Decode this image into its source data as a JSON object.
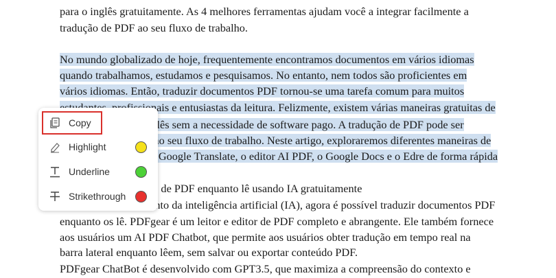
{
  "document": {
    "lines": [
      {
        "text": "para o inglês gratuitamente. As 4 melhores ferramentas ajudam você a integrar facilmente a"
      },
      {
        "text": "tradução de PDF ao seu fluxo de trabalho."
      },
      {
        "text": ""
      },
      {
        "text": "No mundo globalizado de hoje, frequentemente encontramos documentos em vários idiomas"
      },
      {
        "text": "quando trabalhamos, estudamos e pesquisamos. No entanto, nem todos são proficientes em"
      },
      {
        "text": "vários idiomas. Então, traduzir documentos PDF tornou-se uma tarefa comum para muitos"
      },
      {
        "text": "estudantes, profissionais e entusiastas da leitura. Felizmente, existem várias maneiras gratuitas de"
      },
      {
        "text": "traduzir PDF para inglês sem a necessidade de software pago. A tradução de PDF pode ser"
      },
      {
        "text": "integrada facilmente ao seu fluxo de trabalho. Neste artigo, exploraremos diferentes maneiras de"
      },
      {
        "text": "traduzir PDF, como o Google Translate, o editor AI PDF, o Google Docs e o Edre de forma rápida"
      },
      {
        "text": ""
      },
      {
        "text": "1. PDFgear: Tradução de PDF enquanto lê usando IA gratuitamente"
      },
      {
        "text": "Com o desenvolvimento da inteligência artificial (IA), agora é possível traduzir documentos PDF"
      },
      {
        "text": "enquanto os lê. PDFgear é um leitor e editor de PDF completo e abrangente. Ele também fornece"
      },
      {
        "text": "aos usuários um AI PDF Chatbot, que permite aos usuários obter tradução em tempo real na"
      },
      {
        "text": "barra lateral enquanto lêem, sem salvar ou exportar conteúdo PDF."
      },
      {
        "text": "PDFgear ChatBot é desenvolvido com GPT3.5, que maximiza a compreensão do contexto e"
      }
    ]
  },
  "context_menu": {
    "items": [
      {
        "label": "Copy",
        "icon": "copy-icon"
      },
      {
        "label": "Highlight",
        "icon": "highlighter-icon",
        "color": "#f5e11b"
      },
      {
        "label": "Underline",
        "icon": "underline-icon",
        "color": "#4cd137"
      },
      {
        "label": "Strikethrough",
        "icon": "strikethrough-icon",
        "color": "#e8312e"
      }
    ]
  },
  "colors": {
    "selection": "#cfdff0",
    "copy_outline": "#d9302b"
  }
}
